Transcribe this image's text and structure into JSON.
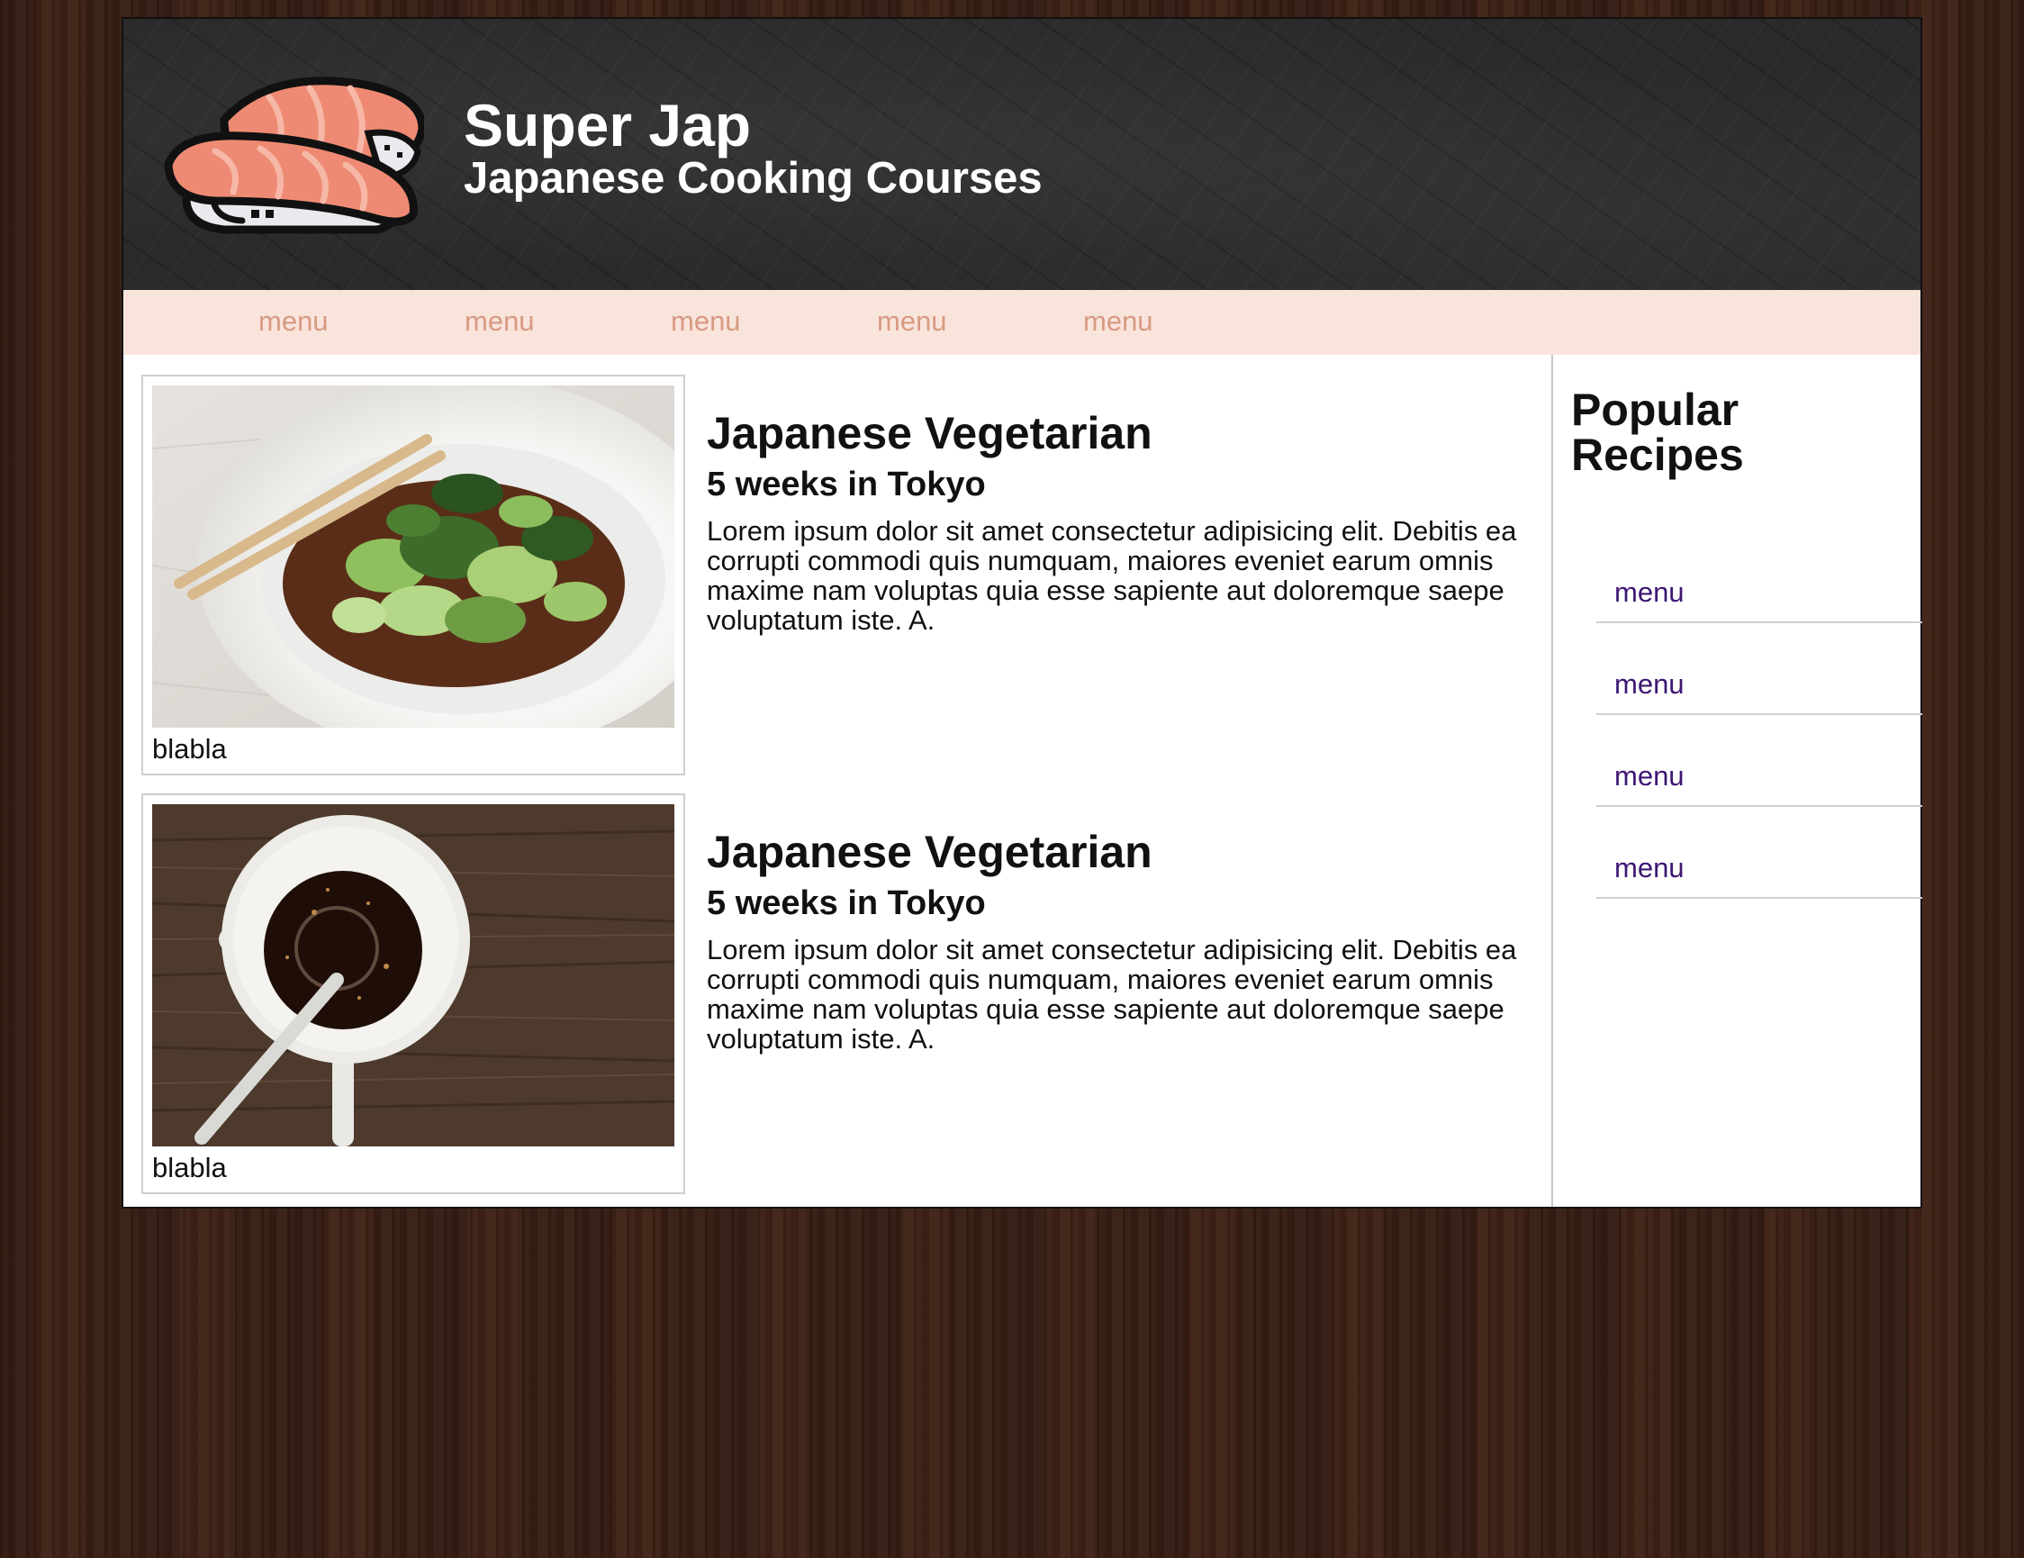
{
  "header": {
    "title": "Super Jap",
    "subtitle": "Japanese Cooking Courses",
    "logo_icon": "sushi-nigiri-icon"
  },
  "nav": {
    "items": [
      {
        "label": "menu"
      },
      {
        "label": "menu"
      },
      {
        "label": "menu"
      },
      {
        "label": "menu"
      },
      {
        "label": "menu"
      }
    ]
  },
  "articles": [
    {
      "image": "bok-choy-bowl-photo",
      "caption": "blabla",
      "title": "Japanese Vegetarian",
      "subtitle": "5 weeks in Tokyo",
      "body": "Lorem ipsum dolor sit amet consectetur adipisicing elit. Debitis ea corrupti commodi quis numquam, maiores eveniet earum omnis maxime nam voluptas quia esse sapiente aut doloremque saepe voluptatum iste. A."
    },
    {
      "image": "soy-sauce-cup-photo",
      "caption": "blabla",
      "title": "Japanese Vegetarian",
      "subtitle": "5 weeks in Tokyo",
      "body": "Lorem ipsum dolor sit amet consectetur adipisicing elit. Debitis ea corrupti commodi quis numquam, maiores eveniet earum omnis maxime nam voluptas quia esse sapiente aut doloremque saepe voluptatum iste. A."
    }
  ],
  "sidebar": {
    "title": "Popular Recipes",
    "items": [
      {
        "label": "menu"
      },
      {
        "label": "menu"
      },
      {
        "label": "menu"
      },
      {
        "label": "menu"
      }
    ]
  },
  "colors": {
    "nav_bg": "#f9e4db",
    "nav_link": "#d79a82",
    "sidebar_link": "#3d1773",
    "header_bg": "#2a2a2a",
    "page_bg": "#3a1f14"
  }
}
